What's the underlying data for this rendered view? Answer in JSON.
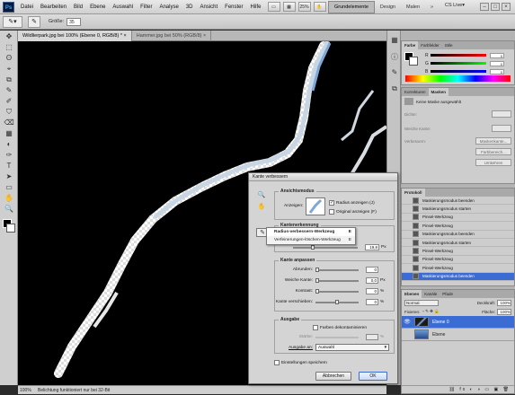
{
  "menubar": {
    "logo": "Ps",
    "items": [
      "Datei",
      "Bearbeiten",
      "Bild",
      "Ebene",
      "Auswahl",
      "Filter",
      "Analyse",
      "3D",
      "Ansicht",
      "Fenster",
      "Hilfe"
    ],
    "toolbar_buttons": [
      "▭",
      "▦",
      "25%",
      "✋",
      "▭",
      "▭"
    ],
    "workspaces": [
      "Grundelemente",
      "Design",
      "Malen"
    ],
    "workspace_more": "»",
    "cslive": "CS Live▾",
    "window_controls": [
      "–",
      "□",
      "×"
    ]
  },
  "options_bar": {
    "size_label": "Größe:",
    "size_value": "35"
  },
  "toolbox": {
    "tools": [
      "✥",
      "⬚",
      "ʘ",
      "⌖",
      "⧉",
      "✎",
      "✐",
      "⛉",
      "⌫",
      "▦",
      "◐",
      "✑",
      "T",
      "➤",
      "▭",
      "✋",
      "🔍"
    ]
  },
  "document": {
    "tabs": [
      "Wildlierpark.jpg bei 100% (Ebene 0, RGB/8) * ×",
      "Hammer.jpg bei 50% (RGB/8) ×"
    ],
    "status_zoom": "100%",
    "status_text": "Belichtung funktioniert nur bei 32-Bit"
  },
  "color_panel": {
    "tabs": [
      "Farbe",
      "Farbfelder",
      "Stile"
    ],
    "rows": [
      {
        "label": "R",
        "value": "0",
        "bar_from": "#000000",
        "bar_to": "#ff0000"
      },
      {
        "label": "G",
        "value": "0",
        "bar_from": "#000000",
        "bar_to": "#00ff00"
      },
      {
        "label": "B",
        "value": "0",
        "bar_from": "#000000",
        "bar_to": "#0000ff"
      }
    ]
  },
  "masks_panel": {
    "tabs": [
      "Korrekturen",
      "Masken"
    ],
    "title": "Keine Maske ausgewählt",
    "rows": [
      {
        "label": "Dichte:",
        "button": ""
      },
      {
        "label": "Weiche Kante:",
        "button": ""
      },
      {
        "label": "Verbessern:",
        "button": "Maskenkante..."
      },
      {
        "label": "",
        "button": "Farbbereich..."
      },
      {
        "label": "",
        "button": "Umkehren"
      }
    ]
  },
  "history_panel": {
    "tabs": [
      "Protokoll"
    ],
    "entries": [
      "Maskierungsmodus beenden",
      "Maskierungsmodus starten",
      "Pinsel-Werkzeug",
      "Pinsel-Werkzeug",
      "Maskierungsmodus beenden",
      "Maskierungsmodus starten",
      "Pinsel-Werkzeug",
      "Pinsel-Werkzeug",
      "Pinsel-Werkzeug",
      "Maskierungsmodus beenden"
    ],
    "selected_index": 9
  },
  "layers_panel": {
    "tabs": [
      "Ebenen",
      "Kanäle",
      "Pfade"
    ],
    "blend_mode": "Normal",
    "opacity_label": "Deckkraft:",
    "opacity_value": "100%",
    "lock_label": "Fixieren:",
    "fill_label": "Fläche:",
    "fill_value": "100%",
    "layers": [
      {
        "name": "Ebene 0",
        "selected": true
      },
      {
        "name": "Ebene",
        "selected": false
      }
    ],
    "footer_icons": "⛓ fx ◐ ◑ ▭ ▣ 🗑"
  },
  "dialog": {
    "title": "Kante verbessern",
    "view_mode": {
      "title": "Ansichtsmodus",
      "show_label": "Anzeigen:",
      "show_radius": "Radius anzeigen (J)",
      "show_original": "Original anzeigen (F)"
    },
    "edge_detection": {
      "title": "Kantenerkennung",
      "radius_value": "19,8",
      "radius_unit": "Px"
    },
    "context_menu": [
      {
        "label": "Radius-verbessern-Werkzeug",
        "key": "E"
      },
      {
        "label": "Verfeinerungen-löschen-Werkzeug",
        "key": "E"
      }
    ],
    "adjust_edge": {
      "title": "Kante anpassen",
      "rows": [
        {
          "label": "Abrunden:",
          "value": "0",
          "unit": "",
          "level": 0.0
        },
        {
          "label": "Weiche Kante:",
          "value": "0,0",
          "unit": "Px",
          "level": 0.0
        },
        {
          "label": "Kontrast:",
          "value": "0",
          "unit": "%",
          "level": 0.0
        },
        {
          "label": "Kante verschieben:",
          "value": "0",
          "unit": "%",
          "level": 0.5
        }
      ]
    },
    "output": {
      "title": "Ausgabe",
      "decontaminate": "Farben dekontaminieren",
      "amount_label": "Stärke:",
      "output_to_label": "Ausgabe an:",
      "output_to_value": "Auswahl"
    },
    "remember": "Einstellungen speichern",
    "cancel": "Abbrechen",
    "ok": "OK"
  },
  "colors": {
    "accent": "#3a6cd3",
    "canvas": "#000000"
  }
}
